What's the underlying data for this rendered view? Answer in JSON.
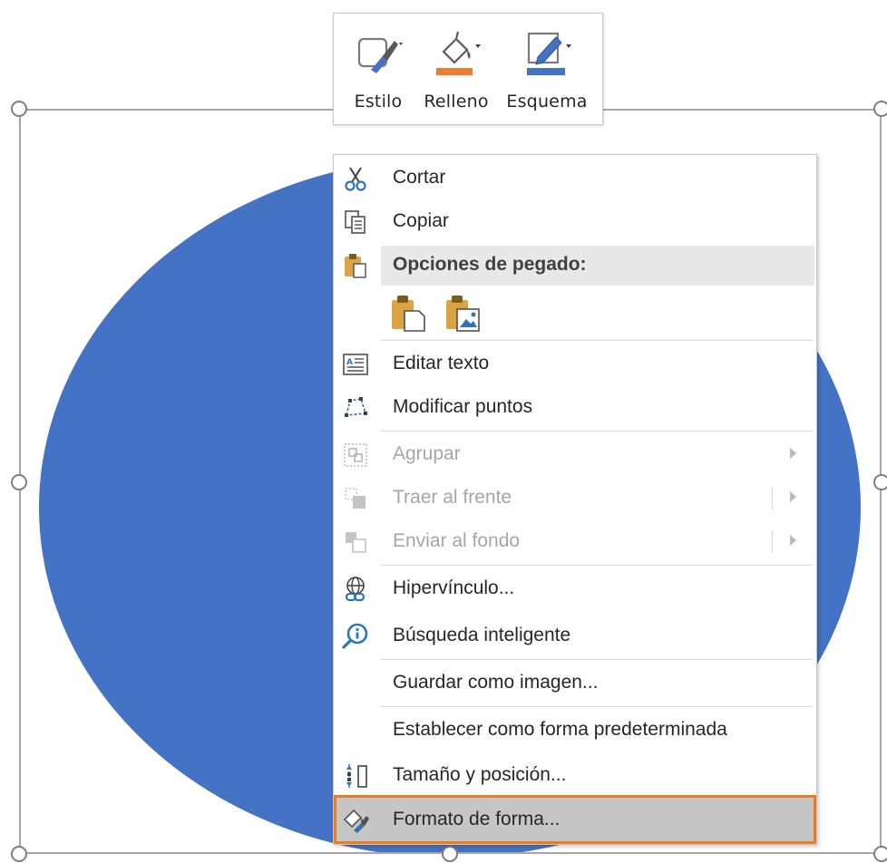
{
  "mini_toolbar": {
    "buttons": [
      {
        "label": "Estilo",
        "icon": "shape-style-icon"
      },
      {
        "label": "Relleno",
        "icon": "paint-bucket-icon",
        "color": "#ED7D31"
      },
      {
        "label": "Esquema",
        "icon": "outline-pen-icon",
        "color": "#4472C4"
      }
    ]
  },
  "shape": {
    "fill": "#4472C4",
    "kind": "ellipse"
  },
  "context_menu": {
    "items": [
      {
        "label": "Cortar",
        "icon": "scissors-icon",
        "enabled": true
      },
      {
        "label": "Copiar",
        "icon": "copy-icon",
        "enabled": true
      },
      {
        "label": "Opciones de pegado:",
        "icon": "paste-icon",
        "header": true
      },
      {
        "label": "Editar texto",
        "icon": "edit-text-icon",
        "enabled": true
      },
      {
        "label": "Modificar puntos",
        "icon": "edit-points-icon",
        "enabled": true
      },
      {
        "label": "Agrupar",
        "icon": "group-icon",
        "enabled": false,
        "submenu": true
      },
      {
        "label": "Traer al frente",
        "icon": "bring-to-front-icon",
        "enabled": false,
        "submenu": true
      },
      {
        "label": "Enviar al fondo",
        "icon": "send-to-back-icon",
        "enabled": false,
        "submenu": true
      },
      {
        "label": "Hipervínculo...",
        "icon": "hyperlink-icon",
        "enabled": true
      },
      {
        "label": "Búsqueda inteligente",
        "icon": "smart-lookup-icon",
        "enabled": true
      },
      {
        "label": "Guardar como imagen...",
        "icon": "",
        "enabled": true
      },
      {
        "label": "Establecer como forma predeterminada",
        "icon": "",
        "enabled": true
      },
      {
        "label": "Tamaño y posición...",
        "icon": "size-position-icon",
        "enabled": true
      },
      {
        "label": "Formato de forma...",
        "icon": "format-shape-icon",
        "enabled": true,
        "highlighted": true
      }
    ],
    "paste_options": [
      {
        "icon": "paste-keep-format-icon"
      },
      {
        "icon": "paste-picture-icon"
      }
    ],
    "highlight_color": "#F07B1C"
  }
}
